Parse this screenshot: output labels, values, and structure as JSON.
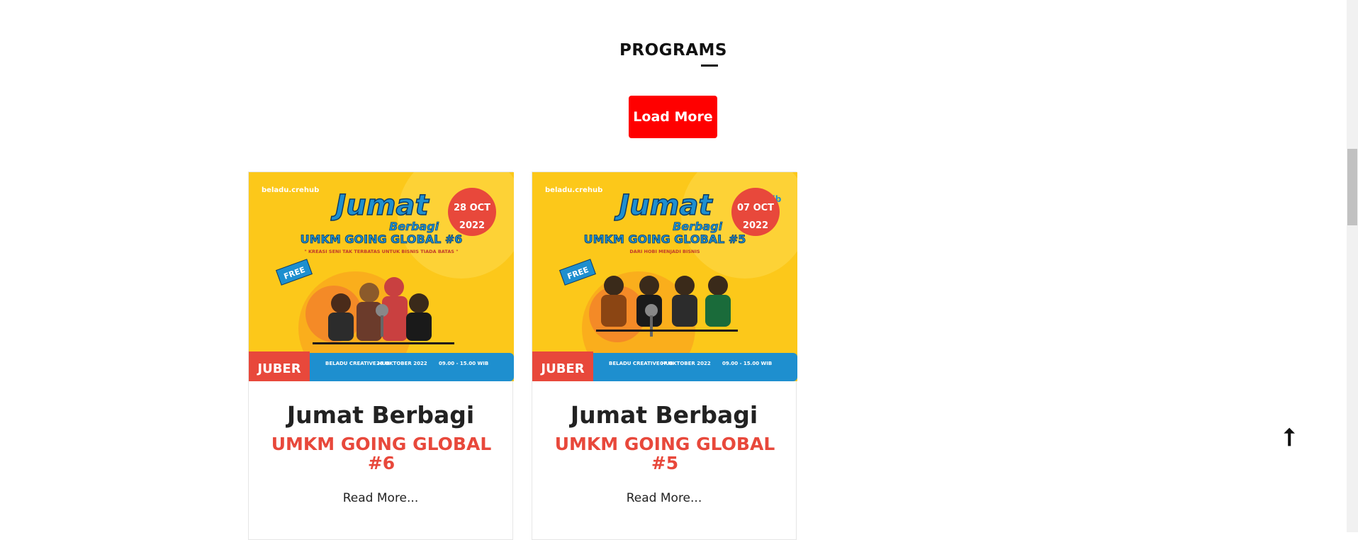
{
  "section": {
    "title": "PROGRAMS"
  },
  "load_more": {
    "label": "Load More"
  },
  "colors": {
    "accent_red": "#ff0000",
    "category_red": "#e8483b",
    "poster_yellow": "#fcc81a",
    "poster_blue": "#1e8fcf"
  },
  "cards": [
    {
      "category": "JUBER",
      "title": "Jumat Berbagi",
      "subtitle": "UMKM GOING GLOBAL #6",
      "read_more": "Read More...",
      "poster": {
        "logo_text": "beladu.crehub",
        "headline": "Jumat",
        "headline_sub": "Berbagi",
        "banner": "UMKM GOING GLOBAL #6",
        "tagline": "\" KREASI SENI TAK TERBATAS UNTUK BISNIS TIADA BATAS \"",
        "date_day": "28 OCT",
        "date_year": "2022",
        "free_label": "FREE",
        "venue": "BELADU CREATIVE HUB",
        "date_strip": "28 OKTOBER 2022",
        "time_strip": "09.00 - 15.00 WIB"
      }
    },
    {
      "category": "JUBER",
      "title": "Jumat Berbagi",
      "subtitle": "UMKM GOING GLOBAL #5",
      "read_more": "Read More...",
      "poster": {
        "logo_text": "beladu.crehub",
        "headline": "Jumat",
        "headline_sub": "Berbagi",
        "banner": "UMKM GOING GLOBAL #5",
        "tagline": "DARI HOBI MENJADI BISNIS",
        "date_day": "07 OCT",
        "date_year": "2022",
        "free_label": "FREE",
        "venue": "BELADU CREATIVE HUB",
        "date_strip": "07 OKTOBER 2022",
        "time_strip": "09.00 - 15.00 WIB",
        "partner": "bjb"
      }
    }
  ],
  "back_to_top": {
    "label": "⭡"
  }
}
